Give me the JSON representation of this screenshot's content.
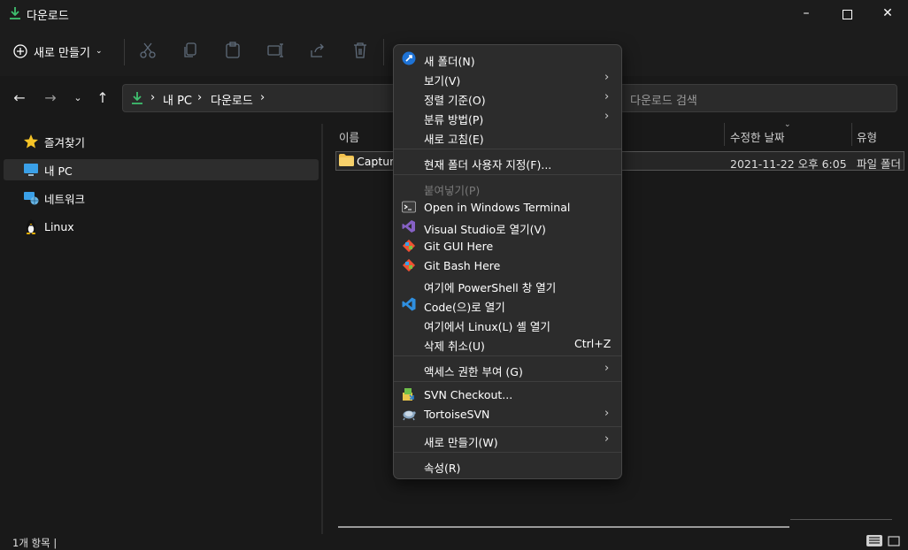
{
  "window": {
    "title": "다운로드",
    "icon": "download-arrow-icon",
    "controls": [
      "minimize-icon",
      "maximize-icon",
      "close-icon"
    ]
  },
  "toolbar": {
    "new_label": "새로 만들기",
    "new_icon": "plus-circle-icon",
    "actions": [
      "cut-icon",
      "copy-icon",
      "paste-icon",
      "rename-icon",
      "share-icon",
      "delete-icon"
    ]
  },
  "nav": {
    "back_icon": "arrow-left-icon",
    "forward_icon": "arrow-right-icon",
    "recent_icon": "chevron-down-icon",
    "up_icon": "arrow-up-icon",
    "breadcrumb": [
      "내 PC",
      "다운로드"
    ],
    "separator": "›",
    "search_placeholder": "다운로드 검색"
  },
  "sidebar": {
    "items": [
      {
        "label": "즐겨찾기",
        "icon": "star-icon",
        "selected": false
      },
      {
        "label": "내 PC",
        "icon": "monitor-icon",
        "selected": true
      },
      {
        "label": "네트워크",
        "icon": "network-icon",
        "selected": false
      },
      {
        "label": "Linux",
        "icon": "tux-icon",
        "selected": false
      }
    ]
  },
  "file_list": {
    "columns": {
      "name": "이름",
      "modified": "수정한 날짜",
      "type": "유형"
    },
    "rows": [
      {
        "name": "Capture",
        "modified": "2021-11-22 오후 6:05",
        "type": "파일 폴더"
      }
    ]
  },
  "status": {
    "text": "1개 항목  |"
  },
  "context_menu": {
    "items": [
      {
        "label": "새 폴더(N)",
        "icon": "new-folder-icon"
      },
      {
        "label": "보기(V)",
        "submenu": true
      },
      {
        "label": "정렬 기준(O)",
        "submenu": true
      },
      {
        "label": "분류 방법(P)",
        "submenu": true
      },
      {
        "label": "새로 고침(E)"
      },
      {
        "label": "현재 폴더 사용자 지정(F)..."
      },
      {
        "label": "붙여넣기(P)",
        "disabled": true
      },
      {
        "label": "Open in Windows Terminal",
        "icon": "terminal-icon"
      },
      {
        "label": "Visual Studio로 열기(V)",
        "icon": "visual-studio-icon"
      },
      {
        "label": "Git GUI Here",
        "icon": "git-icon"
      },
      {
        "label": "Git Bash Here",
        "icon": "git-icon"
      },
      {
        "label": "여기에 PowerShell 창 열기"
      },
      {
        "label": "Code(으)로 열기",
        "icon": "vscode-icon"
      },
      {
        "label": "여기에서 Linux(L) 셸 열기"
      },
      {
        "label": "삭제 취소(U)",
        "shortcut": "Ctrl+Z"
      },
      {
        "label": "액세스 권한 부여 (G)",
        "submenu": true
      },
      {
        "label": "SVN Checkout...",
        "icon": "svn-checkout-icon"
      },
      {
        "label": "TortoiseSVN",
        "icon": "tortoise-svn-icon",
        "submenu": true
      },
      {
        "label": "새로 만들기(W)",
        "submenu": true
      },
      {
        "label": "속성(R)"
      }
    ],
    "arrow_glyph": "›"
  },
  "colors": {
    "background": "#191919",
    "menu_bg": "#2c2c2c",
    "accent_green": "#3fbf6f",
    "folder_yellow": "#f2c14e",
    "vs_purple": "#8661c5",
    "vscode_blue": "#2f8fe0",
    "git_orange": "#f05133"
  }
}
